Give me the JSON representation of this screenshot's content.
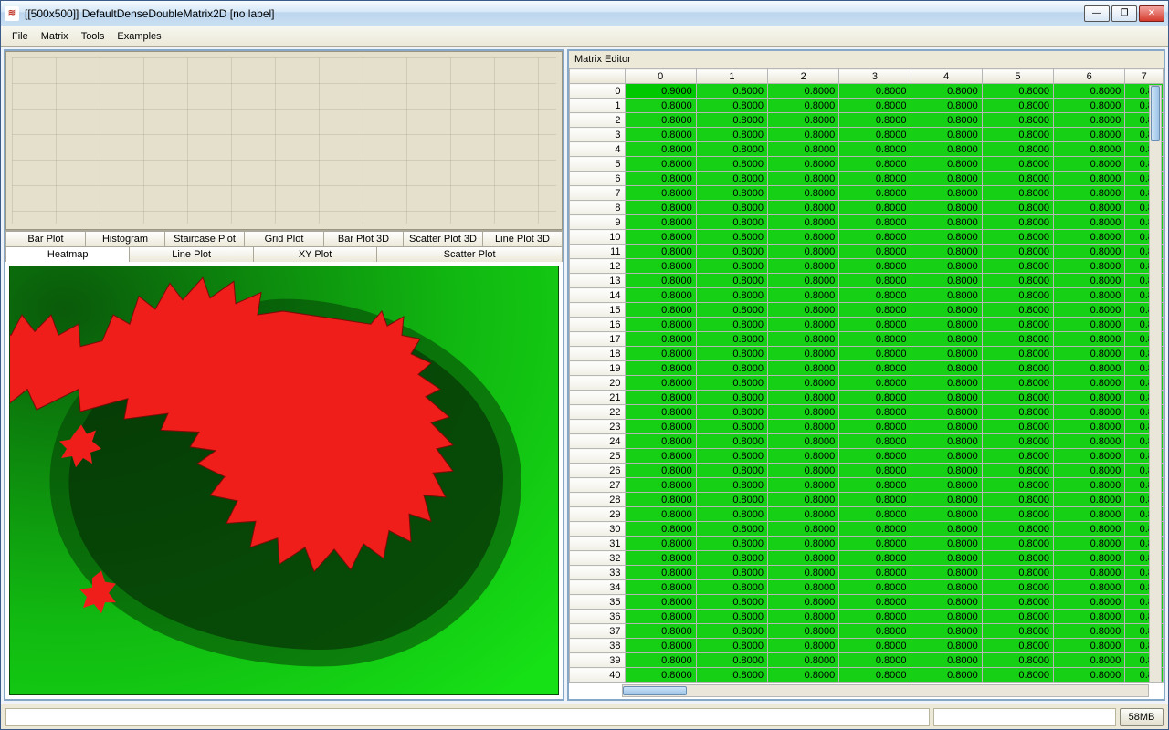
{
  "window": {
    "title": "[[500x500]] DefaultDenseDoubleMatrix2D [no label]"
  },
  "menus": {
    "file": "File",
    "matrix": "Matrix",
    "tools": "Tools",
    "examples": "Examples"
  },
  "tabs_row1": {
    "bar": "Bar Plot",
    "hist": "Histogram",
    "stair": "Staircase Plot",
    "grid": "Grid Plot",
    "bar3d": "Bar Plot 3D",
    "scatter3d": "Scatter Plot 3D",
    "line3d": "Line Plot 3D"
  },
  "tabs_row2": {
    "heatmap": "Heatmap",
    "line": "Line Plot",
    "xy": "XY Plot",
    "scatter": "Scatter Plot"
  },
  "editor": {
    "title": "Matrix Editor",
    "col_headers": [
      "0",
      "1",
      "2",
      "3",
      "4",
      "5",
      "6",
      "7"
    ],
    "row_count": 41,
    "cell_first": "0.9000",
    "cell_value": "0.8000",
    "cell_last": "0.80"
  },
  "status": {
    "mem": "58MB"
  },
  "chart_data": {
    "type": "heatmap",
    "title": "",
    "xlabel": "",
    "ylabel": "",
    "description": "500x500 matrix heatmap; values ≈0.8 background (green gradient), central Mandelbrot-like region high value (red)",
    "value_range": [
      0,
      1
    ],
    "background_value": 0.8,
    "foreground_value": 1.0,
    "grid_shape": [
      500,
      500
    ],
    "colormap": [
      "#004400",
      "#0a7a0a",
      "#12c412",
      "#a0e000",
      "#ffef00",
      "#ff6a00",
      "#ef1a1a"
    ]
  }
}
